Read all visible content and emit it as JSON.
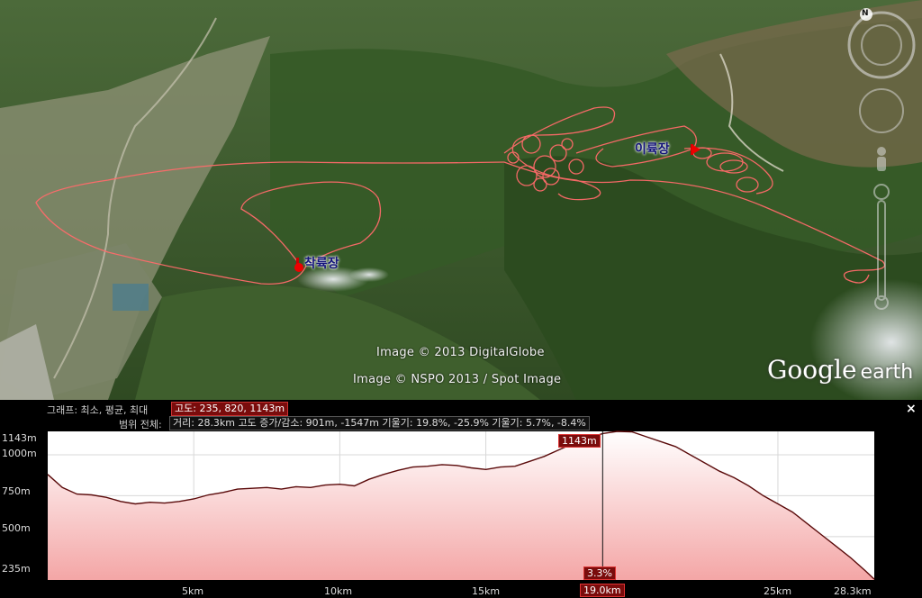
{
  "map": {
    "credits": [
      "Image © 2013 DigitalGlobe",
      "Image © NSPO 2013 / Spot Image"
    ],
    "placemarks": [
      {
        "label": "착륙장"
      },
      {
        "label": "이륙장"
      }
    ],
    "logo": {
      "google": "Google",
      "earth": "earth"
    },
    "compass_letter": "N"
  },
  "profile": {
    "close_label": "×",
    "line1_prefix": "그래프: 최소, 평균, 최대",
    "altitude_box": "고도: 235, 820, 1143m",
    "line2_prefix": "범위 전체:",
    "stats_box": "거리: 28.3km 고도 증가/감소: 901m, -1547m 기울기: 19.8%, -25.9% 기울기: 5.7%, -8.4%",
    "y_ticks": [
      "1143m",
      "1000m",
      "750m",
      "500m",
      "235m"
    ],
    "x_ticks": [
      "5km",
      "10km",
      "15km",
      "25km",
      "28.3km"
    ],
    "cursor_x": "19.0km",
    "cursor_alt": "1143m",
    "cursor_slope": "3.3%",
    "colors": {
      "line": "#5a0a0a",
      "fill_top": "#ffffff",
      "fill_bottom": "#f4a6a6",
      "accent": "#7a0c0c"
    }
  },
  "chart_data": {
    "type": "area",
    "xlabel": "",
    "ylabel": "",
    "xlim": [
      0,
      28.3
    ],
    "ylim": [
      235,
      1143
    ],
    "x": [
      0,
      0.5,
      1,
      1.5,
      2,
      2.5,
      3,
      3.5,
      4,
      4.5,
      5,
      5.5,
      6,
      6.5,
      7,
      7.5,
      8,
      8.5,
      9,
      9.5,
      10,
      10.5,
      11,
      11.5,
      12,
      12.5,
      13,
      13.5,
      14,
      14.5,
      15,
      15.5,
      16,
      16.5,
      17,
      17.5,
      18,
      18.5,
      19,
      19.5,
      20,
      20.5,
      21,
      21.5,
      22,
      22.5,
      23,
      23.5,
      24,
      24.5,
      25,
      25.5,
      26,
      26.5,
      27,
      27.5,
      28,
      28.3
    ],
    "series": [
      {
        "values": [
          880,
          800,
          760,
          755,
          740,
          715,
          700,
          710,
          705,
          715,
          730,
          755,
          770,
          790,
          795,
          800,
          790,
          805,
          800,
          815,
          820,
          810,
          850,
          880,
          905,
          925,
          930,
          940,
          935,
          920,
          910,
          925,
          930,
          960,
          990,
          1030,
          1070,
          1100,
          1130,
          1143,
          1140,
          1110,
          1080,
          1050,
          1000,
          950,
          900,
          860,
          810,
          750,
          700,
          650,
          580,
          510,
          440,
          370,
          290,
          240
        ]
      }
    ]
  }
}
